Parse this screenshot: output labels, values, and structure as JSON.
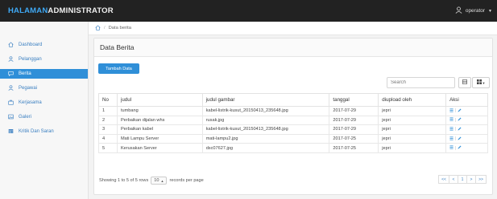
{
  "app": {
    "brand_part1": "HALAMAN",
    "brand_part2": "ADMINISTRATOR",
    "user": "operator",
    "user_icon": "user-icon"
  },
  "colors": {
    "topbar": "#222222",
    "brand_accent": "#3fa9f5",
    "primary": "#2f8fd8",
    "link": "#3a7fc1"
  },
  "sidebar": {
    "items": [
      {
        "label": "Dashboard",
        "icon": "home-icon"
      },
      {
        "label": "Pelanggan",
        "icon": "user-icon"
      },
      {
        "label": "Berita",
        "icon": "chat-icon",
        "active": true
      },
      {
        "label": "Pegawai",
        "icon": "user-icon"
      },
      {
        "label": "Kerjasama",
        "icon": "briefcase-icon"
      },
      {
        "label": "Galeri",
        "icon": "image-icon"
      },
      {
        "label": "Kritik Dan Saran",
        "icon": "table-icon"
      }
    ]
  },
  "breadcrumb": {
    "current": "Data berita",
    "home_icon": "home-icon"
  },
  "panel": {
    "title": "Data Berita",
    "add_button": "Tambah Data"
  },
  "search": {
    "placeholder": "Search"
  },
  "table": {
    "headers": [
      "No",
      "judul",
      "judul gambar",
      "tanggal",
      "diupload oleh",
      "Aksi"
    ],
    "rows": [
      [
        "1",
        "tumbang",
        "kabel-listrik-kusut_20150413_235648.jpg",
        "2017-07-29",
        "jepri"
      ],
      [
        "2",
        "Perbaikan dijalan whs",
        "rusak.jpg",
        "2017-07-29",
        "jepri"
      ],
      [
        "3",
        "Perbaikan kabel",
        "kabel-listrik-kusut_20150413_235648.jpg",
        "2017-07-29",
        "jepri"
      ],
      [
        "4",
        "Mati Lampu Server",
        "mati-lampu2.jpg",
        "2017-07-25",
        "jepri"
      ],
      [
        "5",
        "Kerusakan Server",
        "dsc07627.jpg",
        "2017-07-25",
        "jepri"
      ]
    ]
  },
  "pager": {
    "info_prefix": "Showing 1 to 5 of 5 rows",
    "page_size": "10",
    "info_suffix": "records per page",
    "first": "<<",
    "prev": "<",
    "current": "1",
    "next": ">",
    "last": ">>"
  }
}
